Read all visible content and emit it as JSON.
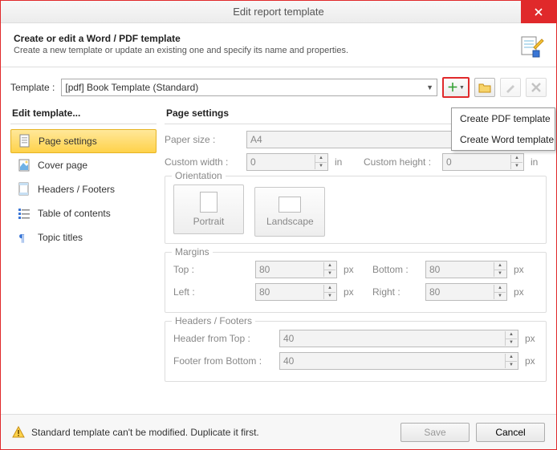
{
  "title": "Edit report template",
  "header": {
    "h": "Create or edit a Word / PDF template",
    "p": "Create a new template or update an existing one and specify its name and properties."
  },
  "template": {
    "label": "Template :",
    "value": "[pdf] Book Template (Standard)"
  },
  "dropdown": {
    "pdf": "Create PDF template",
    "word": "Create Word template"
  },
  "side": {
    "title": "Edit template...",
    "page_settings": "Page settings",
    "cover_page": "Cover page",
    "headers_footers": "Headers / Footers",
    "toc": "Table of contents",
    "topic_titles": "Topic titles"
  },
  "main": {
    "title": "Page settings",
    "paper_size": "Paper size :",
    "paper_size_val": "A4",
    "custom_width": "Custom width :",
    "custom_width_val": "0",
    "custom_height": "Custom height :",
    "custom_height_val": "0",
    "unit_in": "in",
    "orientation": "Orientation",
    "portrait": "Portrait",
    "landscape": "Landscape",
    "margins": "Margins",
    "top": "Top :",
    "top_val": "80",
    "bottom": "Bottom :",
    "bottom_val": "80",
    "left": "Left :",
    "left_val": "80",
    "right": "Right :",
    "right_val": "80",
    "px": "px",
    "hf": "Headers / Footers",
    "header_from_top": "Header from Top :",
    "header_from_top_val": "40",
    "footer_from_bottom": "Footer from Bottom :",
    "footer_from_bottom_val": "40"
  },
  "footer": {
    "msg": "Standard template can't be modified. Duplicate it first.",
    "save": "Save",
    "cancel": "Cancel"
  }
}
